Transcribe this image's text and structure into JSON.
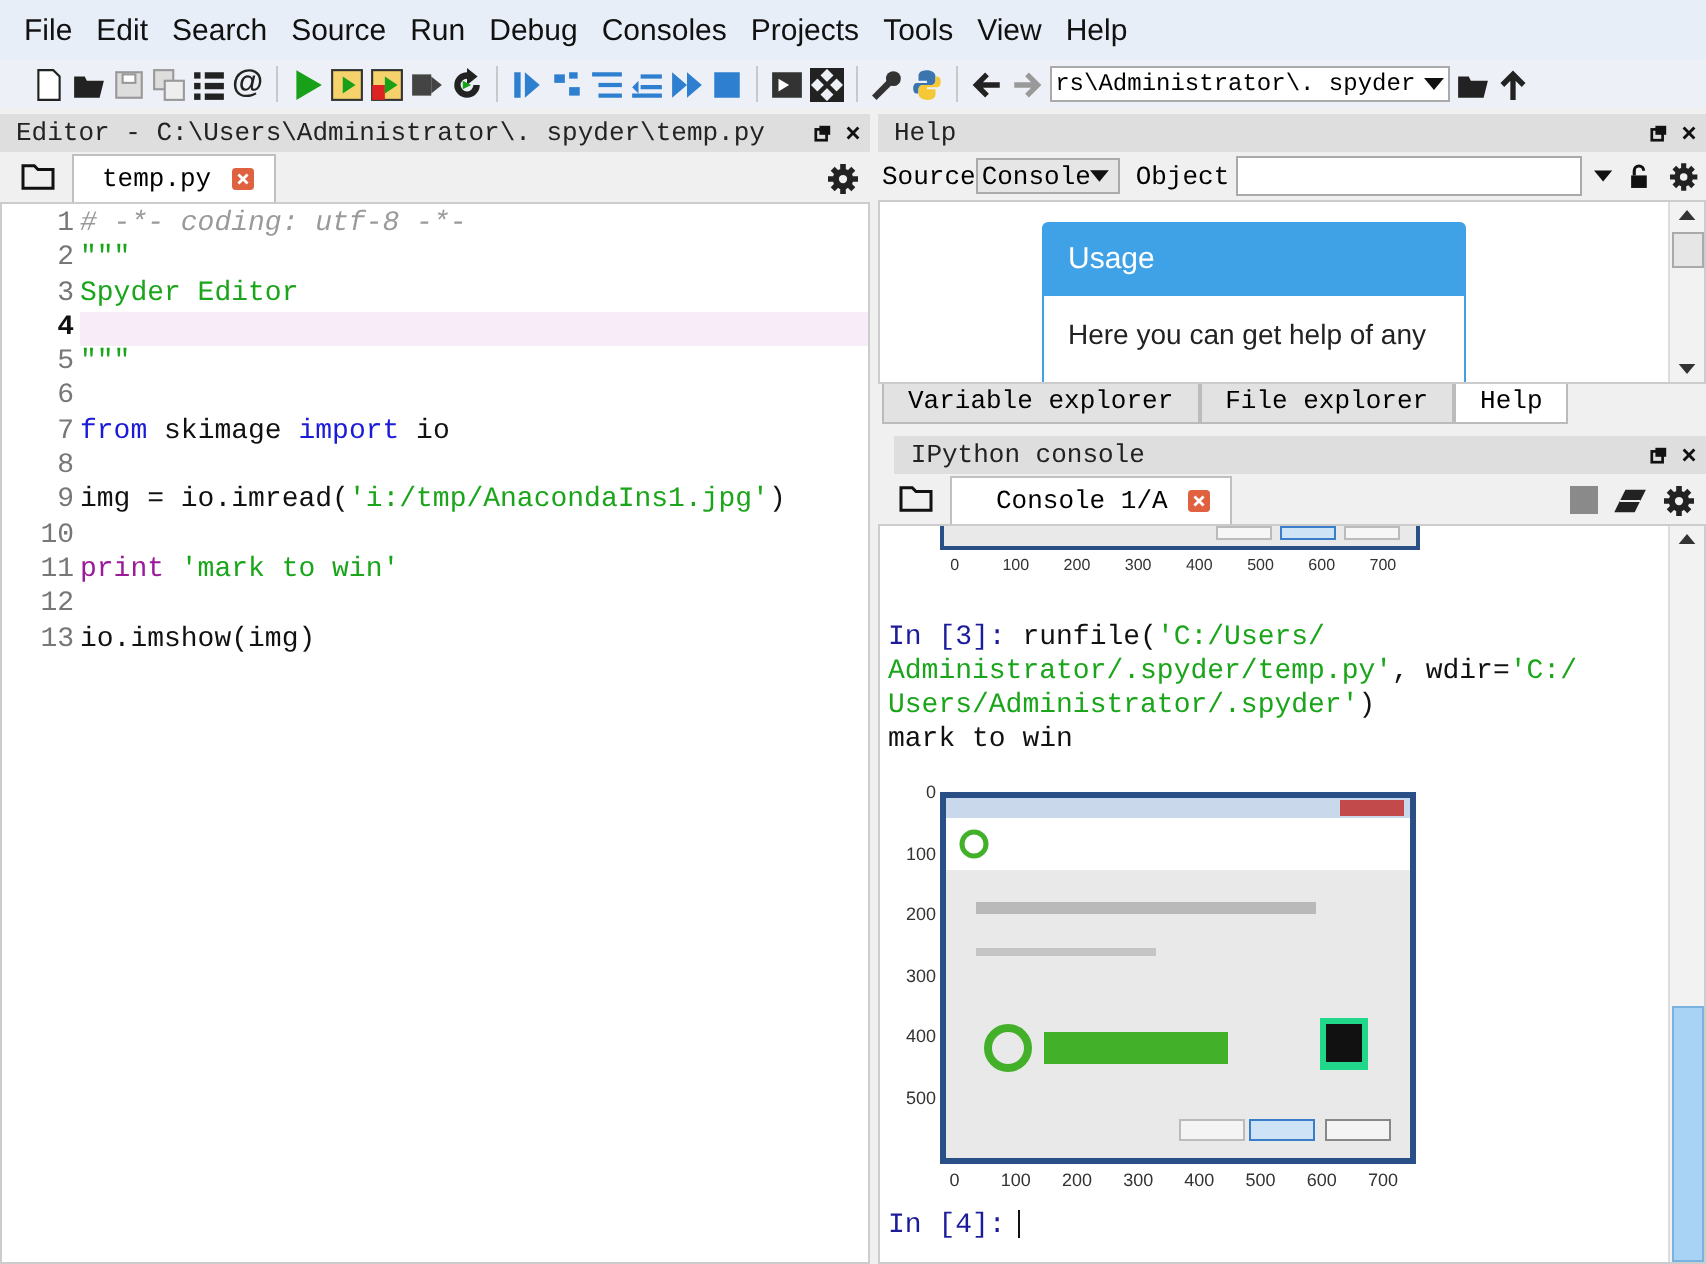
{
  "menu": [
    "File",
    "Edit",
    "Search",
    "Source",
    "Run",
    "Debug",
    "Consoles",
    "Projects",
    "Tools",
    "View",
    "Help"
  ],
  "toolbar": {
    "at_sign": "@",
    "path": "rs\\Administrator\\. spyder"
  },
  "editor": {
    "title": "Editor - C:\\Users\\Administrator\\. spyder\\temp.py",
    "tabs": [
      {
        "label": "temp.py",
        "selected": true
      }
    ],
    "lines": [
      {
        "n": "1",
        "current": false,
        "parts": [
          {
            "kind": "comment",
            "text": "# -*- coding: utf-8 -*-"
          }
        ]
      },
      {
        "n": "2",
        "current": false,
        "parts": [
          {
            "kind": "string",
            "text": "\"\"\""
          }
        ]
      },
      {
        "n": "3",
        "current": false,
        "parts": [
          {
            "kind": "string",
            "text": "Spyder Editor"
          }
        ]
      },
      {
        "n": "4",
        "current": true
      },
      {
        "n": "5",
        "current": false,
        "parts": [
          {
            "kind": "string",
            "text": "\"\"\""
          }
        ]
      },
      {
        "n": "6",
        "current": false
      },
      {
        "n": "7",
        "current": false,
        "parts": [
          {
            "kind": "keyword",
            "text": "from"
          },
          {
            "kind": "plain",
            "text": " skimage "
          },
          {
            "kind": "keyword",
            "text": "import"
          },
          {
            "kind": "plain",
            "text": " io"
          }
        ]
      },
      {
        "n": "8",
        "current": false
      },
      {
        "n": "9",
        "current": false,
        "parts": [
          {
            "kind": "plain",
            "text": "img = io.imread("
          },
          {
            "kind": "string",
            "text": "'i:/tmp/AnacondaIns1.jpg'"
          },
          {
            "kind": "plain",
            "text": ")"
          }
        ]
      },
      {
        "n": "10",
        "current": false
      },
      {
        "n": "11",
        "current": false,
        "parts": [
          {
            "kind": "builtin",
            "text": "print"
          },
          {
            "kind": "string",
            "text": "'mark to win'",
            "gap": true
          }
        ]
      },
      {
        "n": "12",
        "current": false
      },
      {
        "n": "13",
        "current": false,
        "parts": [
          {
            "kind": "plain",
            "text": "io.imshow(img)"
          }
        ]
      }
    ]
  },
  "help": {
    "title": "Help",
    "source_label": "Source",
    "source_value": "Console",
    "object_label": "Object",
    "card_title": "Usage",
    "card_lines": [
      "Here you can get help of any"
    ],
    "tabs": [
      {
        "label": "Variable explorer",
        "selected": false
      },
      {
        "label": "File explorer",
        "selected": false
      },
      {
        "label": "Help",
        "selected": true
      }
    ]
  },
  "console": {
    "title": "IPython console",
    "tabs": [
      {
        "label": "Console 1/A",
        "selected": true
      }
    ],
    "blocks": [
      {
        "kind": "plot_tail",
        "xticks": [
          "0",
          "100",
          "200",
          "300",
          "400",
          "500",
          "600",
          "700"
        ]
      },
      {
        "kind": "input",
        "prompt": "In [3]:",
        "lines": [
          [
            {
              "kind": "plain",
              "text": " runfile("
            },
            {
              "kind": "string",
              "text": "'C:/Users/"
            }
          ],
          [
            {
              "kind": "string",
              "text": "Administrator/.spyder/temp.py'"
            },
            {
              "kind": "plain",
              "text": ", wdir="
            },
            {
              "kind": "string",
              "text": "'C:/"
            }
          ],
          [
            {
              "kind": "string",
              "text": "Users/Administrator/.spyder'"
            },
            {
              "kind": "plain",
              "text": ")"
            }
          ]
        ]
      },
      {
        "kind": "output",
        "text": "mark to win"
      },
      {
        "kind": "plot",
        "xticks": [
          "0",
          "100",
          "200",
          "300",
          "400",
          "500",
          "600",
          "700"
        ],
        "yticks": [
          "0",
          "100",
          "200",
          "300",
          "400",
          "500"
        ]
      },
      {
        "kind": "prompt",
        "prompt": "In [4]:"
      }
    ]
  }
}
